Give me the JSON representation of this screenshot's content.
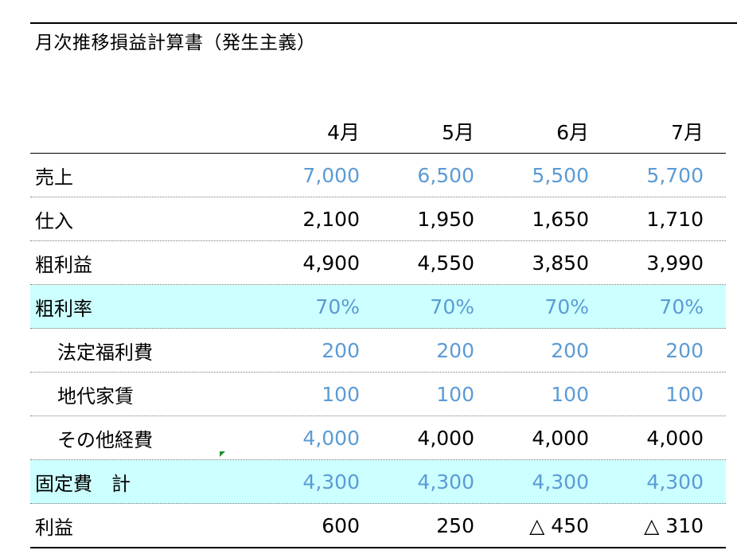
{
  "title": "月次推移損益計算書（発生主義）",
  "headers": [
    "4月",
    "5月",
    "6月",
    "7月"
  ],
  "rows": [
    {
      "label": "売上",
      "values": [
        "7,000",
        "6,500",
        "5,500",
        "5,700"
      ],
      "colors": [
        "blue",
        "blue",
        "blue",
        "blue"
      ]
    },
    {
      "label": "仕入",
      "values": [
        "2,100",
        "1,950",
        "1,650",
        "1,710"
      ],
      "colors": [
        "black",
        "black",
        "black",
        "black"
      ]
    },
    {
      "label": "粗利益",
      "values": [
        "4,900",
        "4,550",
        "3,850",
        "3,990"
      ],
      "colors": [
        "black",
        "black",
        "black",
        "black"
      ]
    },
    {
      "label": "粗利率",
      "values": [
        "70%",
        "70%",
        "70%",
        "70%"
      ],
      "colors": [
        "blue",
        "blue",
        "blue",
        "blue"
      ]
    },
    {
      "label": "法定福利費",
      "values": [
        "200",
        "200",
        "200",
        "200"
      ],
      "colors": [
        "blue",
        "blue",
        "blue",
        "blue"
      ]
    },
    {
      "label": "地代家賃",
      "values": [
        "100",
        "100",
        "100",
        "100"
      ],
      "colors": [
        "blue",
        "blue",
        "blue",
        "blue"
      ]
    },
    {
      "label": "その他経費",
      "values": [
        "4,000",
        "4,000",
        "4,000",
        "4,000"
      ],
      "colors": [
        "blue",
        "black",
        "black",
        "black"
      ]
    },
    {
      "label": "固定費　計",
      "values": [
        "4,300",
        "4,300",
        "4,300",
        "4,300"
      ],
      "colors": [
        "blue",
        "blue",
        "blue",
        "blue"
      ]
    },
    {
      "label": "利益",
      "values": [
        "600",
        "250",
        "△ 450",
        "△ 310"
      ],
      "colors": [
        "black",
        "black",
        "black",
        "black"
      ]
    }
  ],
  "colors": {
    "highlight": "#ccffff",
    "blue_text": "#5b9bd5"
  }
}
